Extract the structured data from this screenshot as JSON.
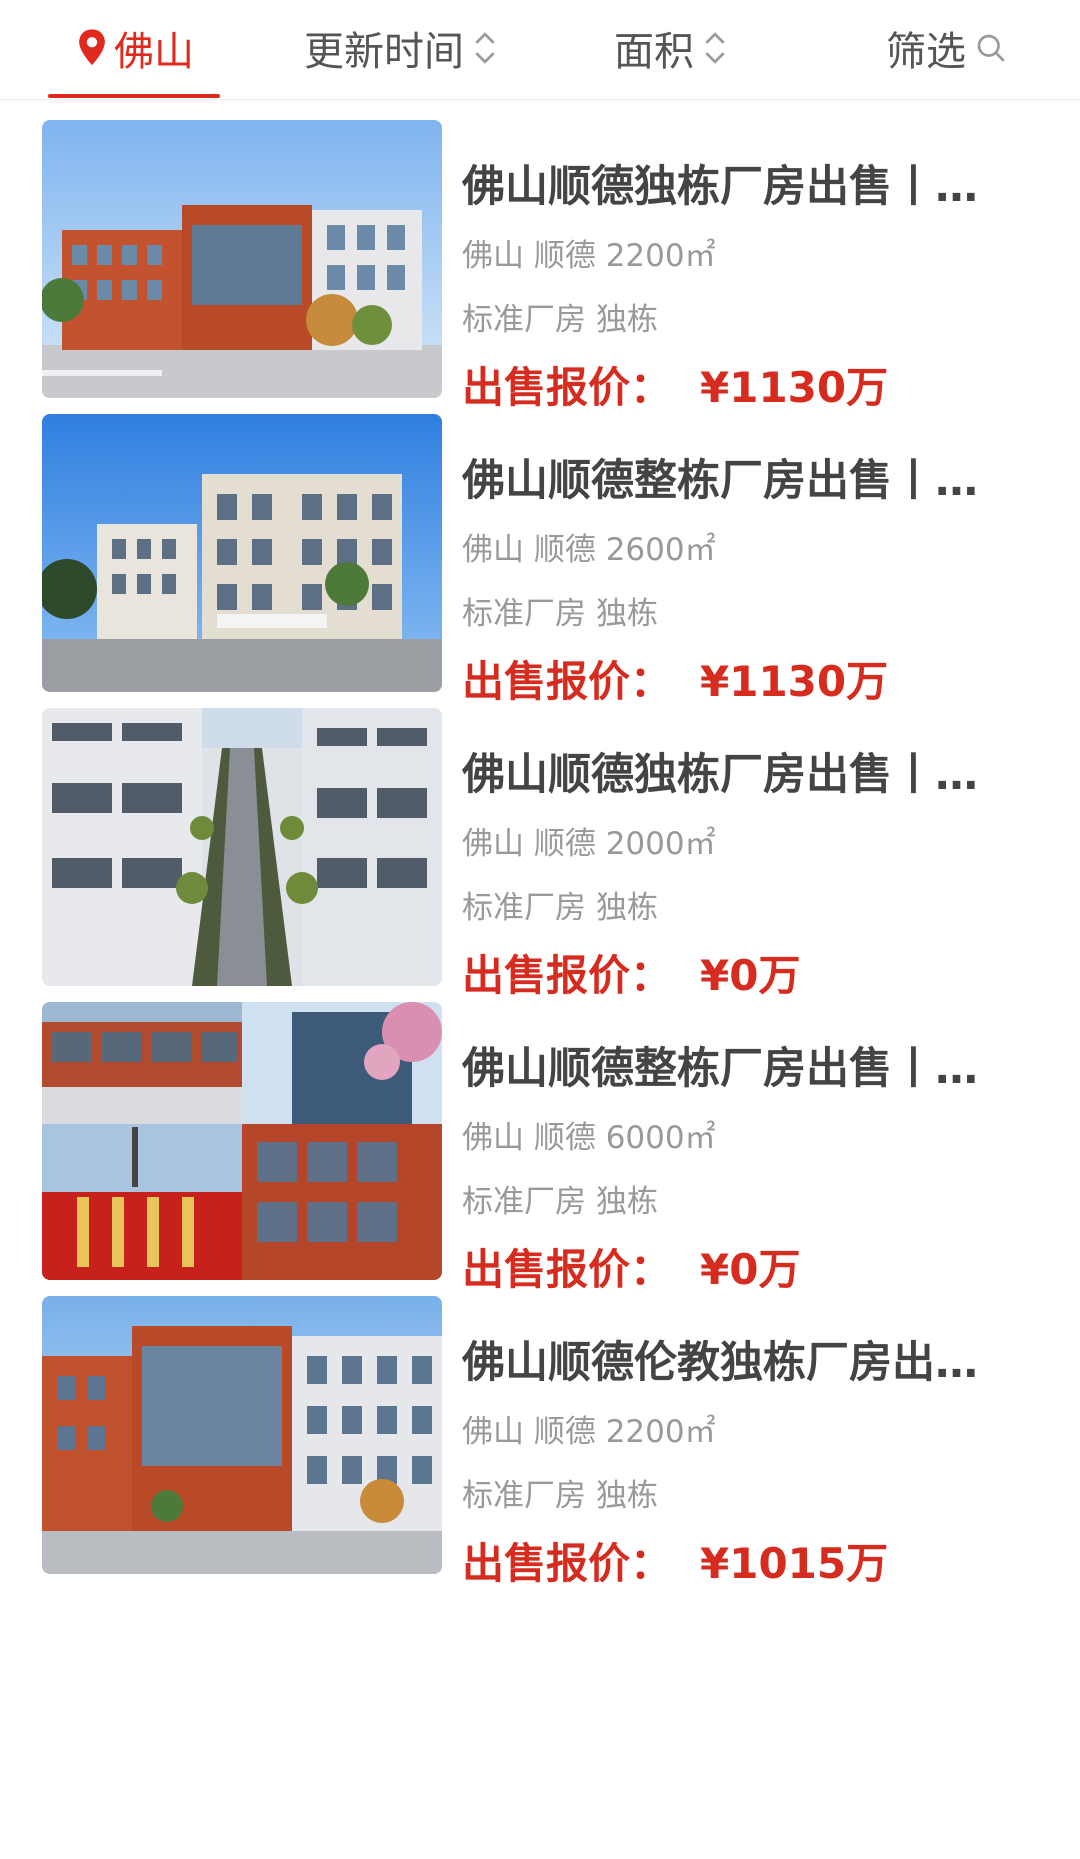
{
  "filter_bar": {
    "city": "佛山",
    "sort_time": "更新时间",
    "sort_area": "面积",
    "filter": "筛选"
  },
  "colors": {
    "accent": "#e02a1d",
    "price": "#d62b1f"
  },
  "listings": [
    {
      "title": "佛山顺德独栋厂房出售丨…",
      "location": "佛山 顺德 2200㎡",
      "tags": [
        "标准厂房",
        "独栋"
      ],
      "price_label": "出售报价：",
      "price": "¥1130万",
      "image": "red-brick-factory-building"
    },
    {
      "title": "佛山顺德整栋厂房出售丨…",
      "location": "佛山 顺德 2600㎡",
      "tags": [
        "标准厂房",
        "独栋"
      ],
      "price_label": "出售报价：",
      "price": "¥1130万",
      "image": "white-factory-building"
    },
    {
      "title": "佛山顺德独栋厂房出售丨…",
      "location": "佛山 顺德 2000㎡",
      "tags": [
        "标准厂房",
        "独栋"
      ],
      "price_label": "出售报价：",
      "price": "¥0万",
      "image": "factory-park-road"
    },
    {
      "title": "佛山顺德整栋厂房出售丨…",
      "location": "佛山 顺德 6000㎡",
      "tags": [
        "标准厂房",
        "独栋"
      ],
      "price_label": "出售报价：",
      "price": "¥0万",
      "image": "factory-collage"
    },
    {
      "title": "佛山顺德伦教独栋厂房出…",
      "location": "佛山 顺德 2200㎡",
      "tags": [
        "标准厂房",
        "独栋"
      ],
      "price_label": "出售报价：",
      "price": "¥1015万",
      "image": "red-brick-factory-corner"
    }
  ]
}
